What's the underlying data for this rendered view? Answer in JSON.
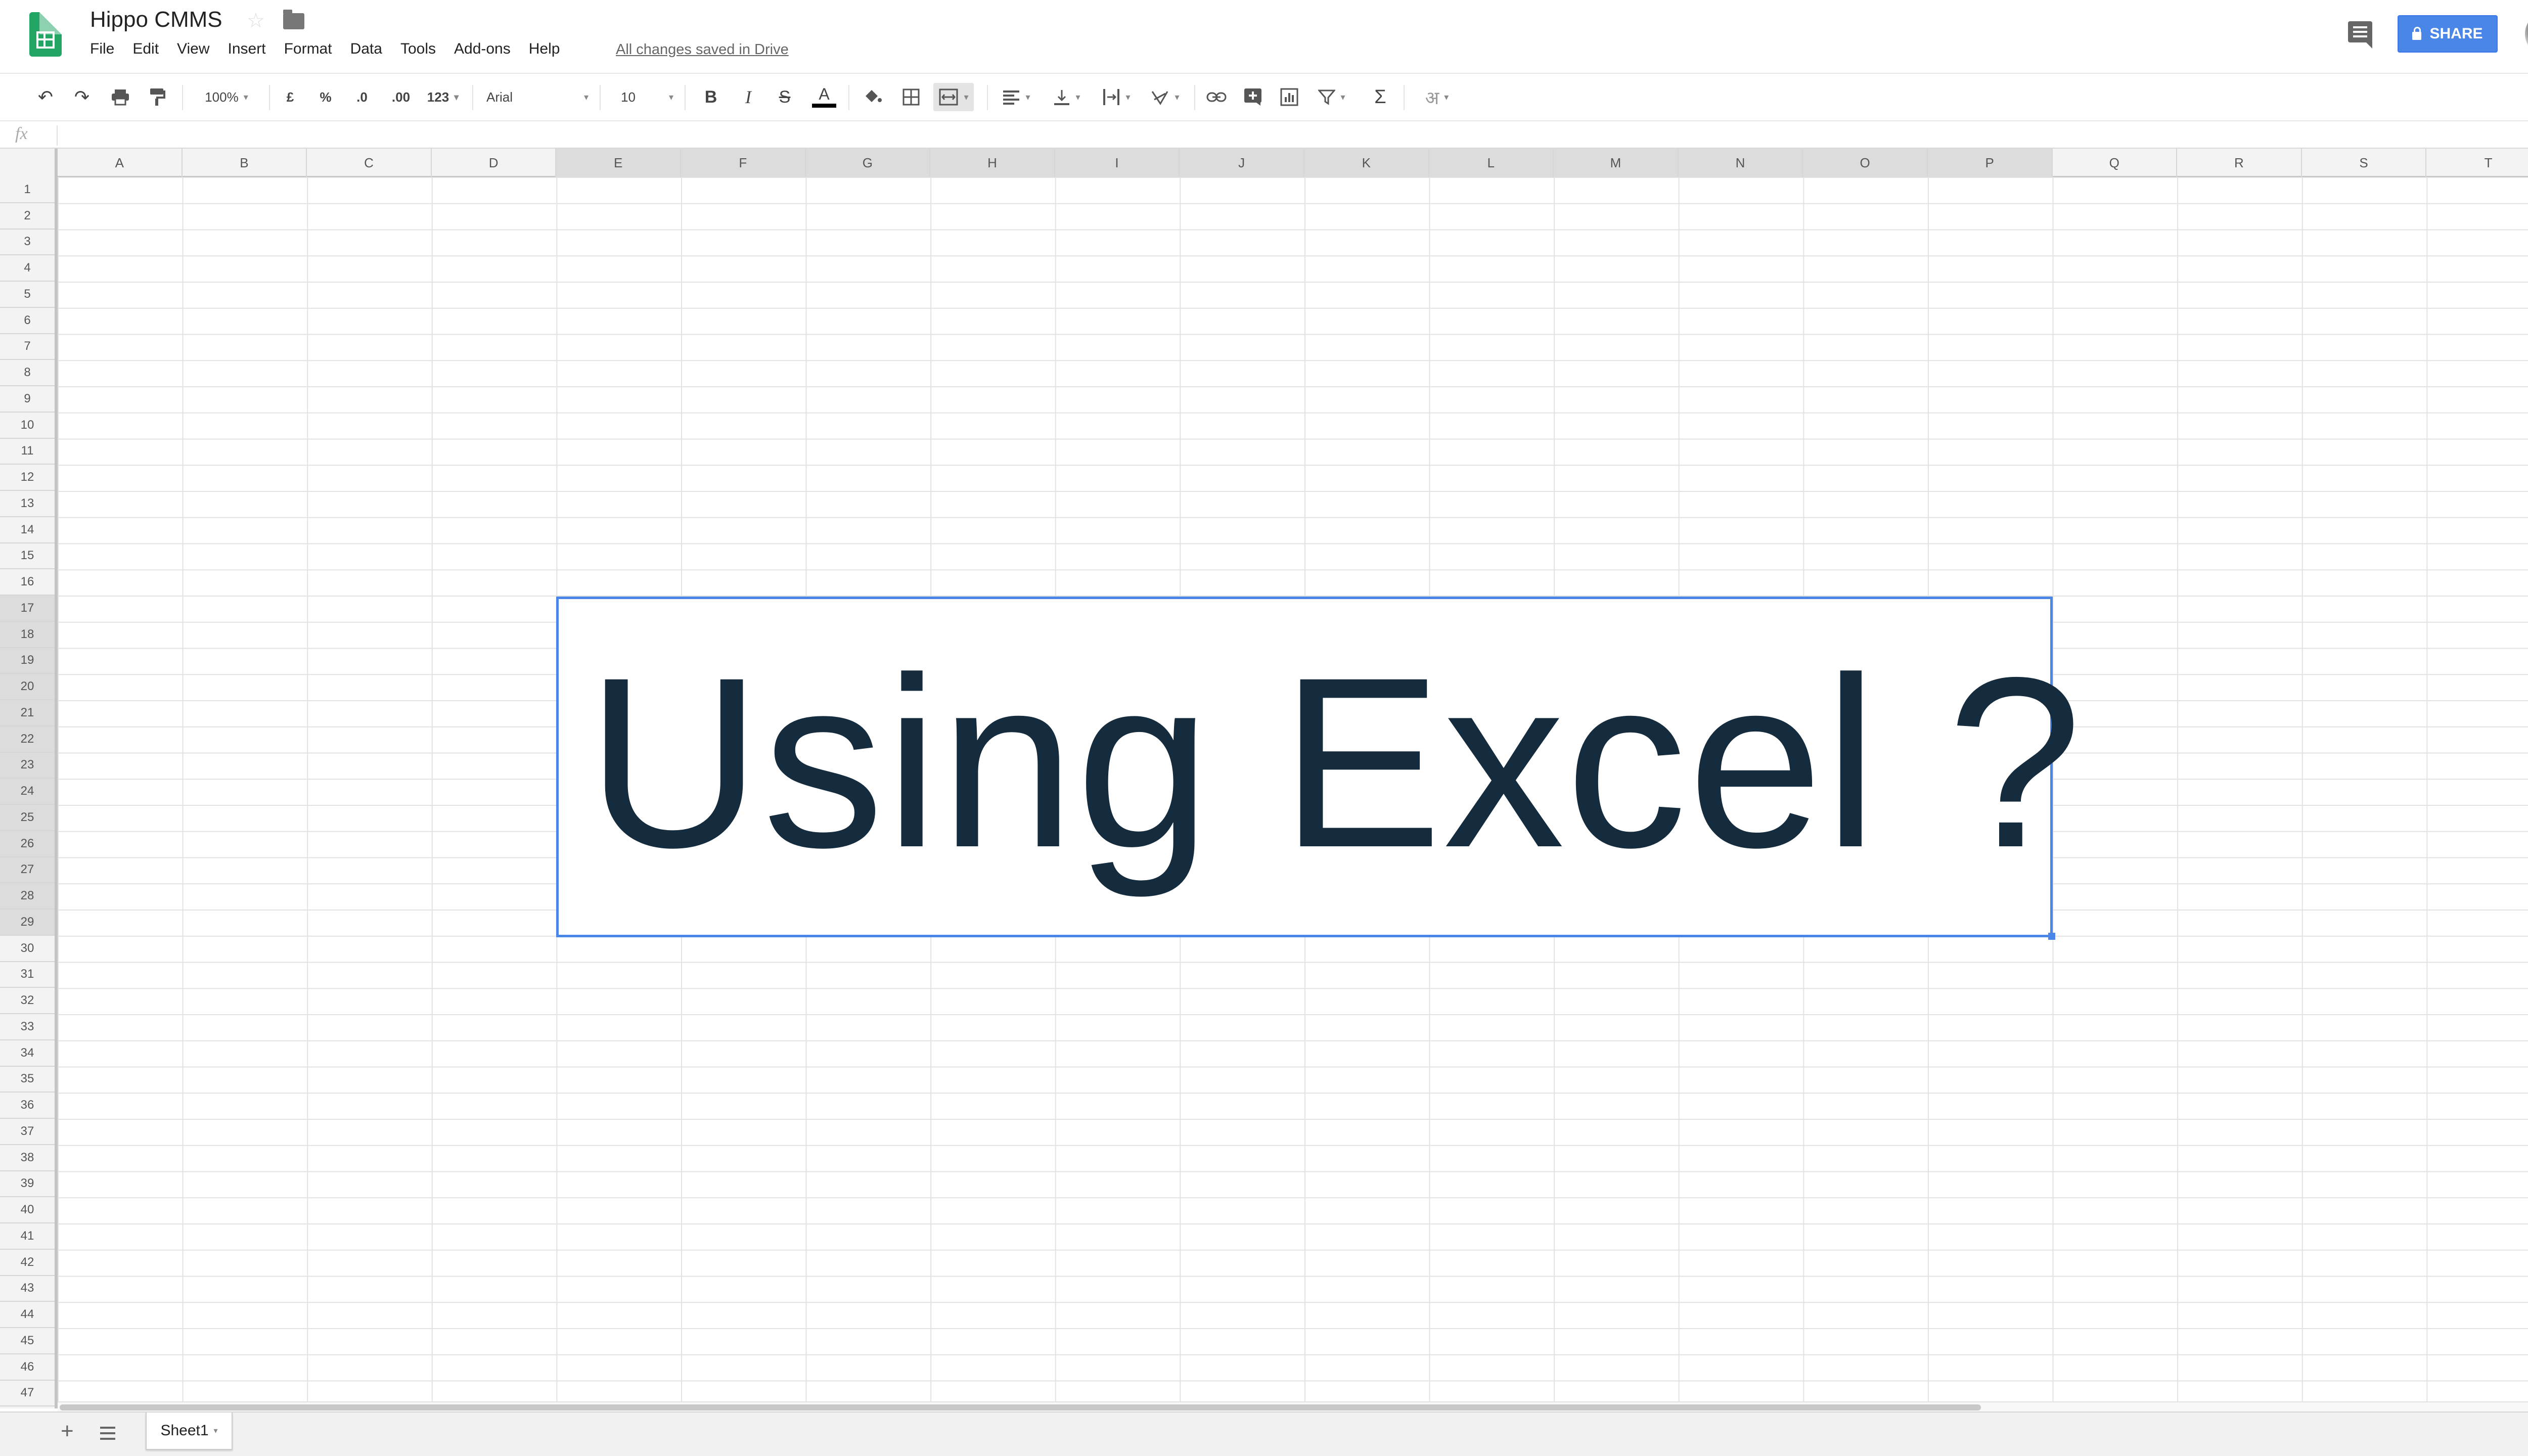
{
  "app": {
    "doc_title": "Hippo CMMS",
    "save_status": "All changes saved in Drive",
    "share_label": "SHARE"
  },
  "menu": [
    "File",
    "Edit",
    "View",
    "Insert",
    "Format",
    "Data",
    "Tools",
    "Add-ons",
    "Help"
  ],
  "toolbar": {
    "zoom": "100%",
    "currency": "£",
    "percent": "%",
    "decrease_decimal": ".0",
    "increase_decimal": ".00",
    "more_formats": "123",
    "font": "Arial",
    "font_size": "10",
    "bold": "B",
    "italic": "I",
    "strikethrough": "S",
    "text_color": "A",
    "functions": "Σ",
    "input_tools": "अ"
  },
  "formula_bar": {
    "label": "fx"
  },
  "grid": {
    "columns": [
      "A",
      "B",
      "C",
      "D",
      "E",
      "F",
      "G",
      "H",
      "I",
      "J",
      "K",
      "L",
      "M",
      "N",
      "O",
      "P",
      "Q",
      "R",
      "S",
      "T"
    ],
    "selected_columns": [
      "E",
      "F",
      "G",
      "H",
      "I",
      "J",
      "K",
      "L",
      "M",
      "N",
      "O",
      "P"
    ],
    "rows": [
      "1",
      "2",
      "3",
      "4",
      "5",
      "6",
      "7",
      "8",
      "9",
      "10",
      "11",
      "12",
      "13",
      "14",
      "15",
      "16",
      "17",
      "18",
      "19",
      "20",
      "21",
      "22",
      "23",
      "24",
      "25",
      "26",
      "27",
      "28",
      "29",
      "30",
      "31",
      "32",
      "33",
      "34",
      "35",
      "36",
      "37",
      "38",
      "39",
      "40",
      "41",
      "42",
      "43",
      "44",
      "45",
      "46",
      "47"
    ],
    "selected_rows": [
      "17",
      "18",
      "19",
      "20",
      "21",
      "22",
      "23",
      "24",
      "25",
      "26",
      "27",
      "28",
      "29"
    ]
  },
  "drawing": {
    "text": "Using Excel ?",
    "text_color": "#142c3e",
    "border_color": "#4a86e8"
  },
  "sheets": {
    "active_tab": "Sheet1"
  },
  "colors": {
    "accent": "#4a86e8",
    "logo": "#23a566"
  }
}
